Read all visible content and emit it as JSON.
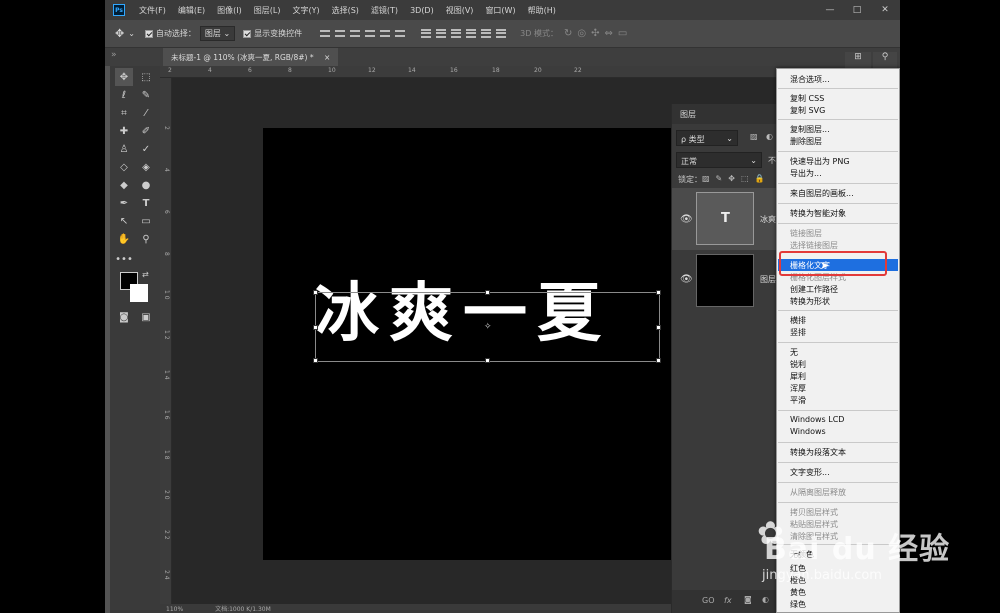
{
  "app": {
    "logo": "Ps",
    "menu": [
      "文件(F)",
      "编辑(E)",
      "图像(I)",
      "图层(L)",
      "文字(Y)",
      "选择(S)",
      "滤镜(T)",
      "3D(D)",
      "视图(V)",
      "窗口(W)",
      "帮助(H)"
    ],
    "window_controls": [
      "—",
      "□",
      "✕"
    ]
  },
  "options_bar": {
    "auto_select_label": "自动选择：",
    "auto_select_value": "图层",
    "show_transform_label": "显示变换控件",
    "mode_3d_label": "3D 模式："
  },
  "document_tab": {
    "label": "未标题-1 @ 110% (冰爽一夏, RGB/8#) *",
    "close": "×"
  },
  "canvas": {
    "text": "冰爽一夏"
  },
  "rulers": {
    "top_ticks": [
      "2",
      "4",
      "6",
      "8",
      "10",
      "12",
      "14",
      "16",
      "18",
      "20",
      "22"
    ],
    "left_ticks": [
      "2",
      "4",
      "6",
      "8",
      "1 0",
      "1 2",
      "1 4",
      "1 6",
      "1 8",
      "2 0",
      "2 2",
      "2 4"
    ]
  },
  "layers_panel": {
    "title": "图层",
    "filter_value": "ρ 类型",
    "blend_mode": "正常",
    "opacity_label": "不透",
    "lock_label": "锁定：",
    "text_layer_name": "冰爽",
    "bg_layer_name": "图层",
    "text_thumb_glyph": "T",
    "bottom_icons": [
      "GO",
      "fx"
    ]
  },
  "context_menu": {
    "items": [
      {
        "label": "混合选项...",
        "disabled": false
      },
      {
        "label": "复制 CSS",
        "disabled": false
      },
      {
        "label": "复制 SVG",
        "disabled": false
      },
      {
        "label": "复制图层...",
        "disabled": false
      },
      {
        "label": "删除图层",
        "disabled": false
      },
      {
        "label": "快速导出为 PNG",
        "disabled": false
      },
      {
        "label": "导出为...",
        "disabled": false
      },
      {
        "label": "来自图层的画板...",
        "disabled": false
      },
      {
        "label": "转换为智能对象",
        "disabled": false
      },
      {
        "label": "链接图层",
        "disabled": true
      },
      {
        "label": "选择链接图层",
        "disabled": true
      },
      {
        "label": "栅格化文字",
        "disabled": false,
        "highlighted": true
      },
      {
        "label": "栅格化图层样式",
        "disabled": true
      },
      {
        "label": "创建工作路径",
        "disabled": false
      },
      {
        "label": "转换为形状",
        "disabled": false
      },
      {
        "label": "横排",
        "disabled": false
      },
      {
        "label": "竖排",
        "disabled": false
      },
      {
        "label": "无",
        "disabled": false
      },
      {
        "label": "锐利",
        "disabled": false
      },
      {
        "label": "犀利",
        "disabled": false
      },
      {
        "label": "浑厚",
        "disabled": false
      },
      {
        "label": "平滑",
        "disabled": false
      },
      {
        "label": "Windows LCD",
        "disabled": false
      },
      {
        "label": "Windows",
        "disabled": false
      },
      {
        "label": "转换为段落文本",
        "disabled": false
      },
      {
        "label": "文字变形...",
        "disabled": false
      },
      {
        "label": "从隔离图层释放",
        "disabled": true
      },
      {
        "label": "拷贝图层样式",
        "disabled": true
      },
      {
        "label": "粘贴图层样式",
        "disabled": true
      },
      {
        "label": "清除图层样式",
        "disabled": true
      },
      {
        "label": "无颜色",
        "disabled": false
      },
      {
        "label": "红色",
        "disabled": false
      },
      {
        "label": "橙色",
        "disabled": false
      },
      {
        "label": "黄色",
        "disabled": false
      },
      {
        "label": "绿色",
        "disabled": false
      }
    ]
  },
  "status_bar": {
    "zoom": "110%",
    "doc_info": "文档:1000 K/1.30M"
  },
  "watermark": {
    "brand": "Bai du 经验",
    "url": "jingyan.baidu.com"
  },
  "colors": {
    "highlight": "#1e6fe0",
    "annotation": "#e23a3a",
    "ps_blue": "#31a8ff"
  }
}
